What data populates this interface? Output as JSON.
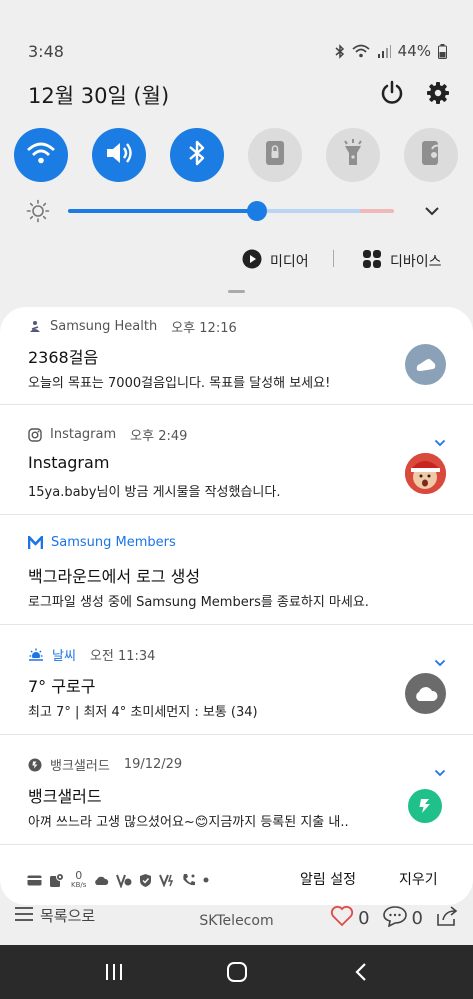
{
  "status_bar": {
    "time": "3:48",
    "battery": "44%",
    "icons": [
      "bluetooth-icon",
      "wifi-icon",
      "signal-icon",
      "battery-icon"
    ]
  },
  "header": {
    "date": "12월 30일 (월)",
    "icons": [
      "power-icon",
      "gear-icon"
    ]
  },
  "quick_settings": {
    "tiles": [
      {
        "icon": "wifi-icon",
        "state": "on"
      },
      {
        "icon": "sound-icon",
        "state": "on"
      },
      {
        "icon": "bluetooth-icon",
        "state": "on"
      },
      {
        "icon": "rotation-lock-icon",
        "state": "off"
      },
      {
        "icon": "flashlight-icon",
        "state": "off"
      },
      {
        "icon": "power-saving-icon",
        "state": "off"
      }
    ],
    "brightness_level": 0.58,
    "colors": {
      "accent": "#1b7ce4",
      "tile_off": "#dcdcdc"
    }
  },
  "media_row": {
    "media_label": "미디어",
    "devices_label": "디바이스"
  },
  "notifications": [
    {
      "app": "Samsung Health",
      "time": "오후 12:16",
      "title": "2368걸음",
      "body": "오늘의 목표는 7000걸음입니다. 목표를 달성해 보세요!",
      "icon": "shoe-icon"
    },
    {
      "app": "Instagram",
      "time": "오후 2:49",
      "title": "Instagram",
      "body": "15ya.baby님이 방금 게시물을 작성했습니다.",
      "icon": "avatar"
    },
    {
      "app": "Samsung Members",
      "time": "",
      "title": "백그라운드에서 로그 생성",
      "body": "로그파일 생성 중에 Samsung Members를 종료하지 마세요.",
      "icon": ""
    },
    {
      "app": "날씨",
      "time": "오전 11:34",
      "title": "7° 구로구",
      "body": "최고 7° | 최저 4° 초미세먼지 : 보통 (34)",
      "icon": "cloud-icon"
    },
    {
      "app": "뱅크샐러드",
      "time": "19/12/29",
      "title": "뱅크샐러드",
      "body": "아껴 쓰느라 고생 많으셨어요~😊지금까지 등록된 지출 내..",
      "icon": "banksalad-icon"
    }
  ],
  "panel_footer": {
    "speed_value": "0",
    "speed_unit": "KB/s",
    "settings_label": "알림 설정",
    "clear_label": "지우기"
  },
  "background_app": {
    "list_label": "목록으로",
    "carrier": "SKTelecom",
    "like_count": "0",
    "comment_count": "0"
  },
  "nav_bar": {
    "icons": [
      "recents-icon",
      "home-icon",
      "back-icon"
    ]
  }
}
